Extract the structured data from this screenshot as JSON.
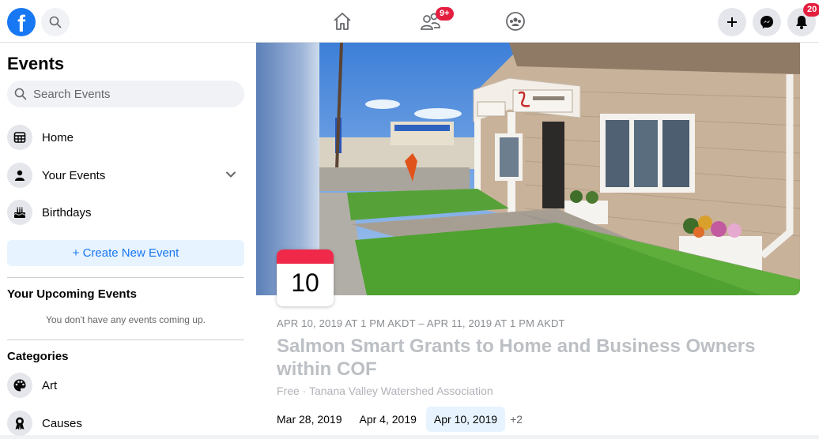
{
  "topbar": {
    "logo": "f",
    "friends_badge": "9+",
    "notifications_badge": "20"
  },
  "sidebar": {
    "title": "Events",
    "search_placeholder": "Search Events",
    "items": [
      {
        "label": "Home",
        "icon": "calendar-icon"
      },
      {
        "label": "Your Events",
        "icon": "person-icon"
      },
      {
        "label": "Birthdays",
        "icon": "cake-icon"
      }
    ],
    "create_button": "+ Create New Event",
    "upcoming_heading": "Your Upcoming Events",
    "upcoming_empty": "You don't have any events coming up.",
    "categories_heading": "Categories",
    "categories": [
      {
        "label": "Art",
        "icon": "palette-icon"
      },
      {
        "label": "Causes",
        "icon": "ribbon-icon"
      }
    ]
  },
  "event": {
    "date_day": "10",
    "datetime": "APR 10, 2019 AT 1 PM AKDT – APR 11, 2019 AT 1 PM AKDT",
    "title": "Salmon Smart Grants to Home and Business Owners within COF",
    "meta": "Free · Tanana Valley Watershed Association",
    "dates": [
      "Mar 28, 2019",
      "Apr 4, 2019",
      "Apr 10, 2019"
    ],
    "more_dates": "+2"
  },
  "colors": {
    "brand": "#1877f2",
    "badge": "#e41e3f",
    "date_card_accent": "#f02849"
  }
}
